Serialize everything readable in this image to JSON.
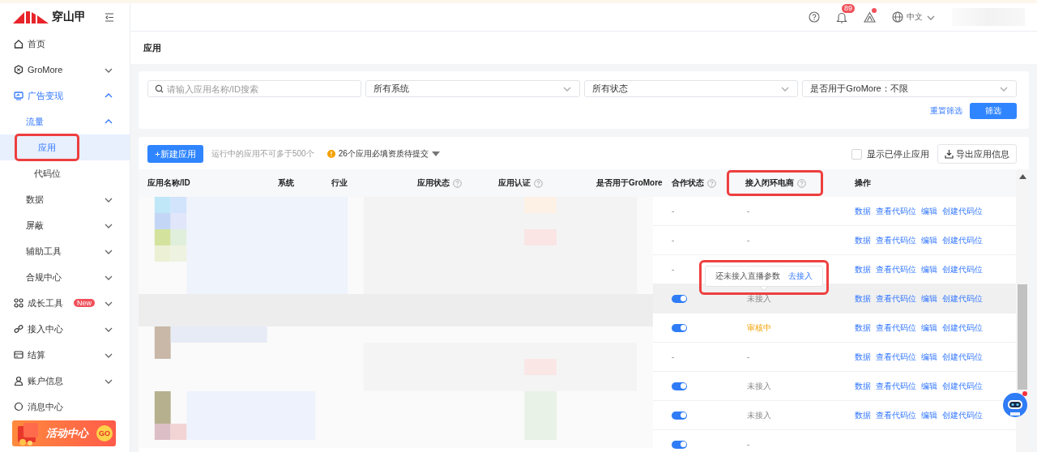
{
  "sidebar": {
    "logo_text": "穿山甲",
    "items": [
      {
        "label": "首页"
      },
      {
        "label": "GroMore",
        "expanded": false
      },
      {
        "label": "广告变现",
        "expanded": true,
        "active": true,
        "children": [
          {
            "label": "流量",
            "expanded": true,
            "active": true,
            "children": [
              {
                "label": "应用",
                "selected": true,
                "annotated": true
              },
              {
                "label": "代码位",
                "selected": false
              }
            ]
          },
          {
            "label": "数据",
            "expanded": false
          },
          {
            "label": "屏蔽",
            "expanded": false
          },
          {
            "label": "辅助工具",
            "expanded": false
          },
          {
            "label": "合规中心",
            "expanded": false
          }
        ]
      },
      {
        "label": "成长工具",
        "expanded": false,
        "badge": "New"
      },
      {
        "label": "接入中心",
        "expanded": false
      },
      {
        "label": "结算",
        "expanded": false
      },
      {
        "label": "账户信息",
        "expanded": false
      },
      {
        "label": "消息中心"
      }
    ],
    "banner": {
      "title": "活动中心",
      "button": "GO"
    }
  },
  "header": {
    "notification_count": "89",
    "alert_dot": true,
    "language": "中文"
  },
  "page_title": "应用",
  "filters": {
    "search": {
      "placeholder": "请输入应用名称/ID搜索"
    },
    "selects": [
      "所有系统",
      "所有状态",
      "是否用于GroMore：不限"
    ],
    "reset": "重置筛选",
    "submit": "筛选"
  },
  "toolbar": {
    "new_button": "+新建应用",
    "hint": "运行中的应用不可多于500个",
    "warning": "26个应用必填资质待提交",
    "show_stopped": {
      "label": "显示已停止应用",
      "checked": false
    },
    "export_button": "导出应用信息"
  },
  "table": {
    "columns": [
      {
        "label": "应用名称/ID"
      },
      {
        "label": "系统"
      },
      {
        "label": "行业"
      },
      {
        "label": "应用状态",
        "help": true
      },
      {
        "label": "应用认证",
        "help": true
      },
      {
        "label": "是否用于GroMore"
      },
      {
        "label": "合作状态",
        "help": true
      },
      {
        "label": "接入闭环电商",
        "help": true,
        "annotated": true
      },
      {
        "label": "操作"
      }
    ],
    "rows": [
      {
        "cooperation": {
          "kind": "text",
          "text": "-"
        },
        "closed_loop": {
          "kind": "text",
          "text": "-"
        },
        "hover": false,
        "actions": [
          "数据",
          "查看代码位",
          "编辑",
          "创建代码位"
        ]
      },
      {
        "cooperation": {
          "kind": "text",
          "text": "-"
        },
        "closed_loop": {
          "kind": "text",
          "text": "-"
        },
        "hover": false,
        "actions": [
          "数据",
          "查看代码位",
          "编辑",
          "创建代码位"
        ]
      },
      {
        "cooperation": {
          "kind": "text",
          "text": "-"
        },
        "closed_loop": {
          "kind": "hidden"
        },
        "hover": false,
        "actions": [
          "数据",
          "查看代码位",
          "编辑",
          "创建代码位"
        ]
      },
      {
        "cooperation": {
          "kind": "switch",
          "on": true
        },
        "closed_loop": {
          "kind": "text",
          "text": "未接入"
        },
        "hover": true,
        "actions": [
          "数据",
          "查看代码位",
          "编辑",
          "创建代码位"
        ],
        "tooltip": {
          "text": "还未接入直播参数",
          "link": "去接入",
          "annotated": true
        }
      },
      {
        "cooperation": {
          "kind": "switch",
          "on": true
        },
        "closed_loop": {
          "kind": "pending",
          "text": "审核中"
        },
        "hover": false,
        "actions": [
          "数据",
          "查看代码位",
          "编辑",
          "创建代码位"
        ]
      },
      {
        "cooperation": {
          "kind": "text",
          "text": "-"
        },
        "closed_loop": {
          "kind": "text",
          "text": "-"
        },
        "hover": false,
        "actions": [
          "数据",
          "查看代码位",
          "编辑",
          "创建代码位"
        ]
      },
      {
        "cooperation": {
          "kind": "switch",
          "on": true
        },
        "closed_loop": {
          "kind": "text",
          "text": "未接入"
        },
        "hover": false,
        "actions": [
          "数据",
          "查看代码位",
          "编辑",
          "创建代码位"
        ]
      },
      {
        "cooperation": {
          "kind": "switch",
          "on": true
        },
        "closed_loop": {
          "kind": "text",
          "text": "未接入"
        },
        "hover": false,
        "actions": [
          "数据",
          "查看代码位",
          "编辑",
          "创建代码位"
        ]
      },
      {
        "cooperation": {
          "kind": "switch",
          "on": true
        },
        "closed_loop": {
          "kind": "text",
          "text": "-"
        },
        "hover": false
      }
    ]
  }
}
